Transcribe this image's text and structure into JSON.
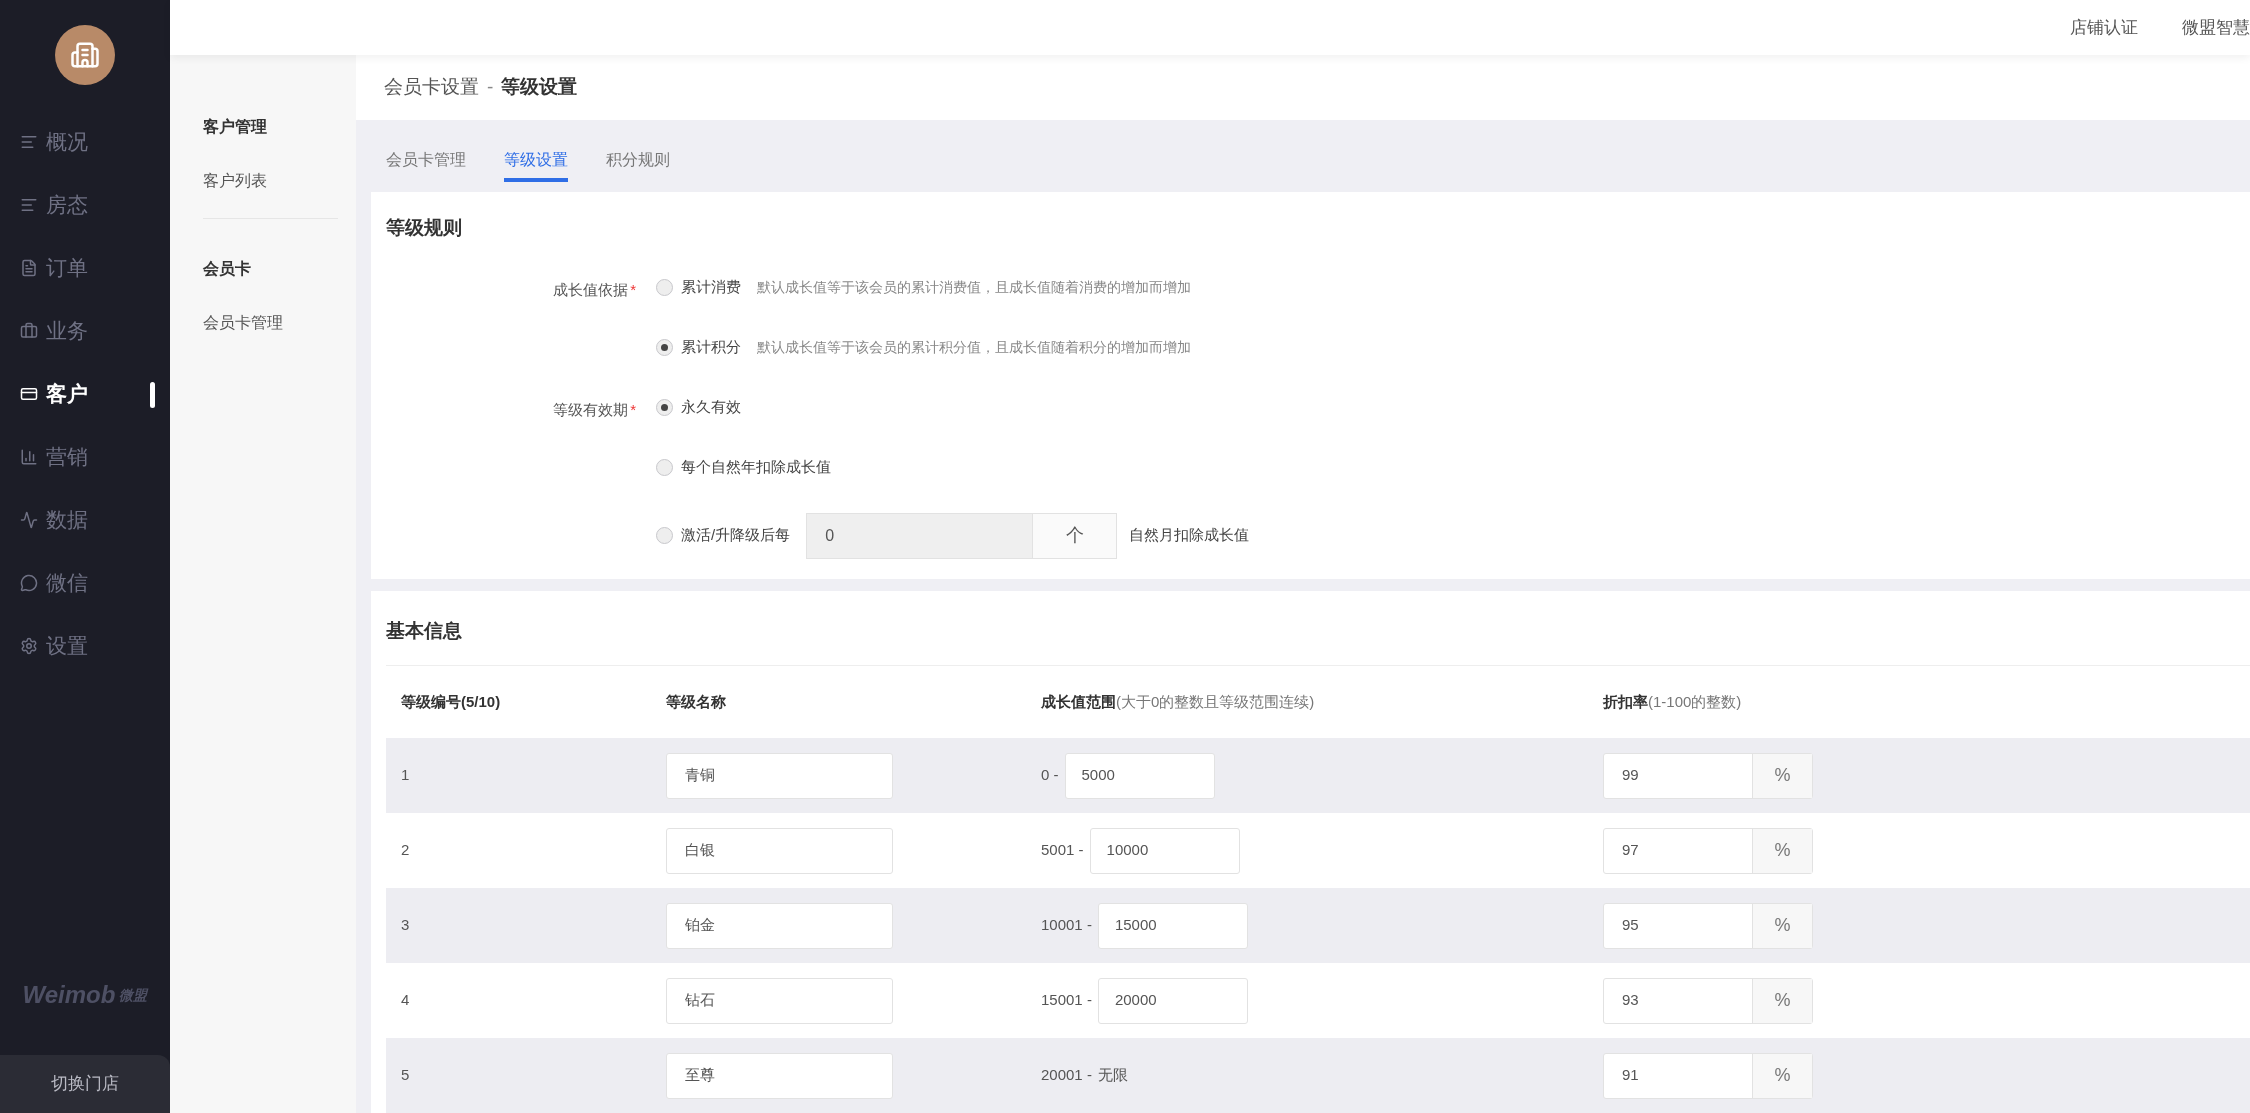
{
  "sidebar": {
    "items": [
      {
        "label": "概况",
        "selected": false
      },
      {
        "label": "房态",
        "selected": false
      },
      {
        "label": "订单",
        "selected": false
      },
      {
        "label": "业务",
        "selected": false
      },
      {
        "label": "客户",
        "selected": true
      },
      {
        "label": "营销",
        "selected": false
      },
      {
        "label": "数据",
        "selected": false
      },
      {
        "label": "微信",
        "selected": false
      },
      {
        "label": "设置",
        "selected": false
      }
    ],
    "brand": "Weimob",
    "brand_sub": "微盟",
    "switch_store": "切换门店"
  },
  "top_bar": {
    "links": [
      "店铺认证",
      "微盟智慧"
    ]
  },
  "sub_nav": {
    "groups": [
      {
        "title": "客户管理",
        "items": [
          {
            "label": "客户列表",
            "selected": false
          }
        ]
      },
      {
        "title": "会员卡",
        "items": [
          {
            "label": "会员卡管理",
            "selected": false
          }
        ]
      }
    ]
  },
  "breadcrumb": {
    "parent": "会员卡设置",
    "separator": "-",
    "current": "等级设置"
  },
  "tabs": [
    {
      "label": "会员卡管理",
      "selected": false
    },
    {
      "label": "等级设置",
      "selected": true
    },
    {
      "label": "积分规则",
      "selected": false
    }
  ],
  "rules": {
    "title": "等级规则",
    "fields": [
      {
        "label": "成长值依据",
        "required_mark": "*",
        "options": [
          {
            "kind": "text",
            "label": "累计消费",
            "hint": "默认成长值等于该会员的累计消费值，且成长值随着消费的增加而增加",
            "selected": false
          },
          {
            "kind": "text",
            "label": "累计积分",
            "hint": "默认成长值等于该会员的累计积分值，且成长值随着积分的增加而增加",
            "selected": true
          }
        ]
      },
      {
        "label": "等级有效期",
        "required_mark": "*",
        "options": [
          {
            "kind": "text",
            "label": "永久有效",
            "selected": true
          },
          {
            "kind": "text",
            "label": "每个自然年扣除成长值",
            "selected": false
          },
          {
            "kind": "input",
            "label": "激活/升降级后每",
            "value": "0",
            "unit": "个",
            "after": "自然月扣除成长值",
            "selected": false
          }
        ]
      }
    ]
  },
  "basic": {
    "title": "基本信息",
    "columns": [
      {
        "label": "等级编号(5/10)"
      },
      {
        "label": "等级名称"
      },
      {
        "label": "成长值范围",
        "note": "(大于0的整数且等级范围连续)"
      },
      {
        "label": "折扣率",
        "note": "(1-100的整数)"
      }
    ],
    "rows": [
      {
        "number": "1",
        "name": "青铜",
        "range": {
          "kind": "input",
          "from": "0 -",
          "to": "5000"
        },
        "discount": "99",
        "unit": "%"
      },
      {
        "number": "2",
        "name": "白银",
        "range": {
          "kind": "input",
          "from": "5001 -",
          "to": "10000"
        },
        "discount": "97",
        "unit": "%"
      },
      {
        "number": "3",
        "name": "铂金",
        "range": {
          "kind": "input",
          "from": "10001 -",
          "to": "15000"
        },
        "discount": "95",
        "unit": "%"
      },
      {
        "number": "4",
        "name": "钻石",
        "range": {
          "kind": "input",
          "from": "15001 -",
          "to": "20000"
        },
        "discount": "93",
        "unit": "%"
      },
      {
        "number": "5",
        "name": "至尊",
        "range": {
          "kind": "text",
          "from": "20001 -",
          "to": "无限"
        },
        "discount": "91",
        "unit": "%"
      }
    ]
  }
}
